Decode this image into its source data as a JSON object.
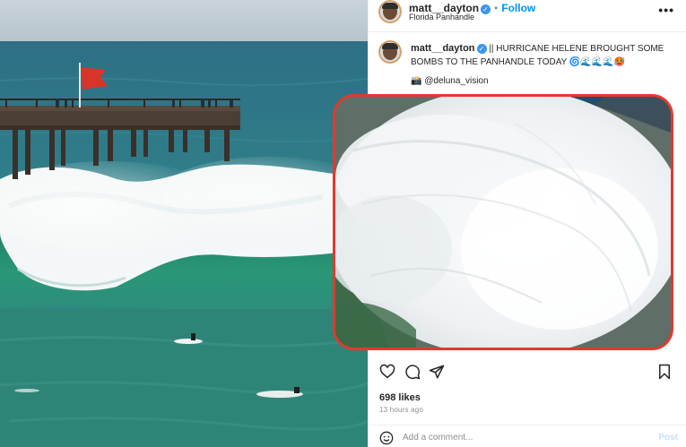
{
  "post": {
    "username": "matt__dayton",
    "verified_mark": "✓",
    "separator": "•",
    "follow_label": "Follow",
    "location": "Florida Panhandle",
    "more_label": "•••",
    "caption_text": "|| HURRICANE HELENE BROUGHT SOME BOMBS TO THE PANHANDLE TODAY 🌀🌊🌊🌊🥵",
    "credit": "📸 @deluna_vision",
    "likes": "698 likes",
    "timestamp": "13 hours ago",
    "comment_placeholder": "Add a comment...",
    "post_label": "Post"
  },
  "icons": {
    "like": "heart-icon",
    "comment": "comment-icon",
    "share": "send-icon",
    "save": "bookmark-icon",
    "emoji": "smiley-icon",
    "options": "more-icon"
  },
  "colors": {
    "accent_blue": "#0095f6",
    "verified_blue": "#3897f0",
    "overlay_border": "#e03a2e",
    "muted_text": "#8e8e8e"
  }
}
